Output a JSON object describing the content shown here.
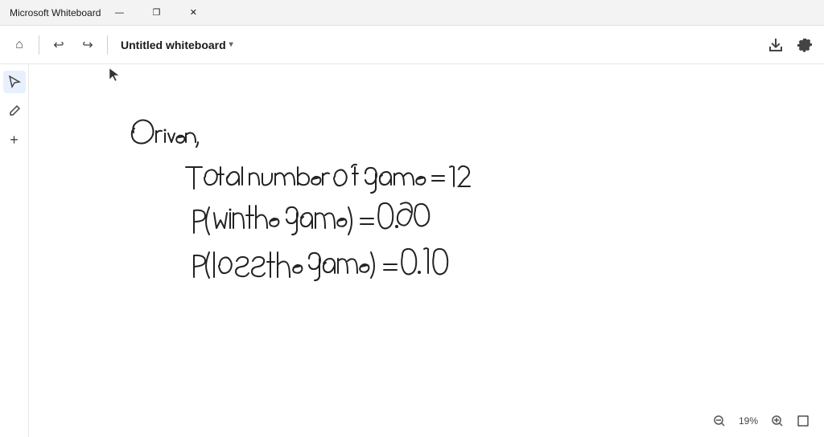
{
  "app": {
    "title": "Microsoft Whiteboard"
  },
  "titlebar": {
    "title": "Microsoft Whiteboard",
    "minimize_label": "—",
    "restore_label": "❐",
    "close_label": "✕"
  },
  "toolbar": {
    "home_label": "⌂",
    "undo_label": "↩",
    "redo_label": "↪",
    "whiteboard_title": "Untitled whiteboard",
    "dropdown_icon": "▾",
    "share_label": "↗",
    "settings_label": "⚙"
  },
  "sidebar": {
    "select_label": "▷",
    "pen_label": "✏",
    "add_label": "+"
  },
  "canvas": {
    "zoom_level": "19%"
  },
  "zoom": {
    "zoom_out_label": "−",
    "zoom_in_label": "+",
    "fit_label": "⛶",
    "level": "19%"
  }
}
